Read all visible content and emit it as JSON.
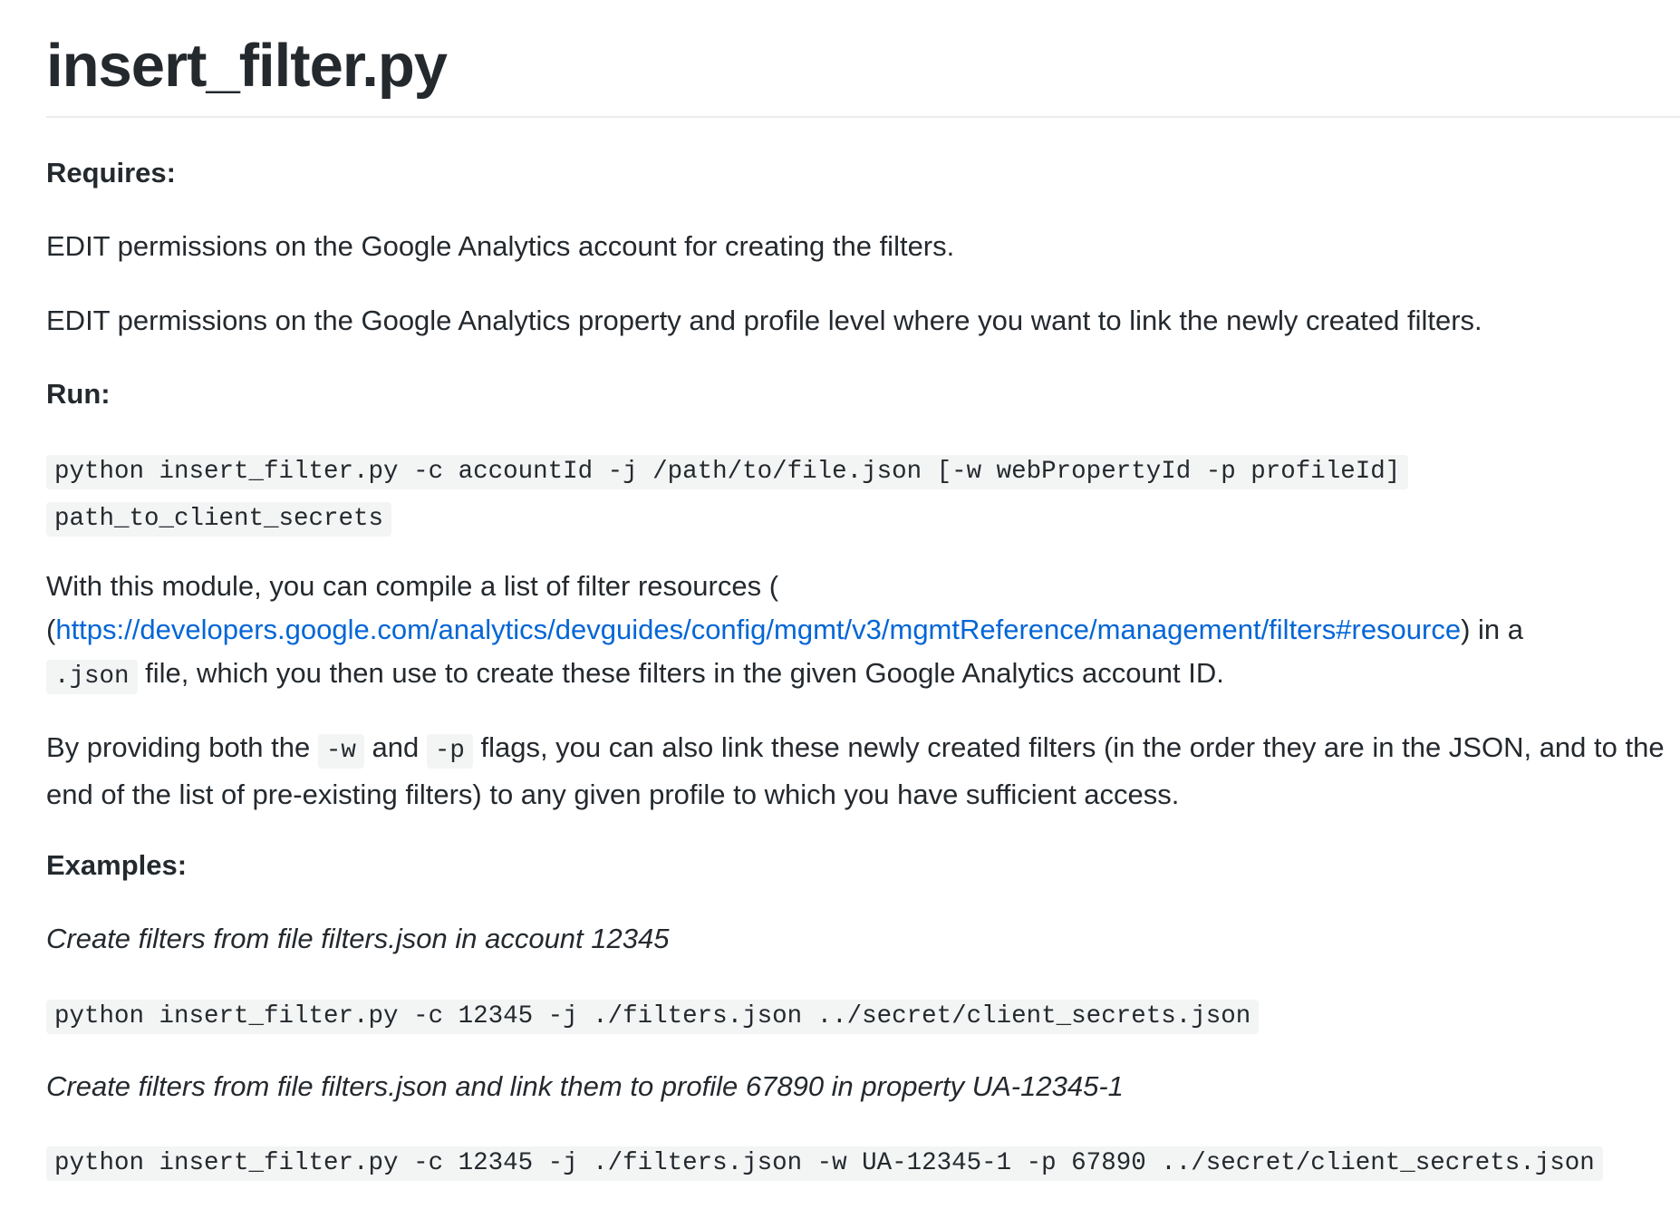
{
  "title": "insert_filter.py",
  "requires": {
    "heading": "Requires:",
    "line1": "EDIT permissions on the Google Analytics account for creating the filters.",
    "line2": "EDIT permissions on the Google Analytics property and profile level where you want to link the newly created filters."
  },
  "run": {
    "heading": "Run:",
    "command": "python insert_filter.py -c accountId -j /path/to/file.json [-w webPropertyId -p profileId] path_to_client_secrets"
  },
  "module": {
    "text_before": "With this module, you can compile a list of filter resources (",
    "link": "https://developers.google.com/analytics/devguides/config/mgmt/v3/mgmtReference/management/filters#resource",
    "text_after_link": ") in a",
    "code": ".json",
    "text_end": " file, which you then use to create these filters in the given Google Analytics account ID."
  },
  "flags": {
    "text1": "By providing both the ",
    "code_w": "-w",
    "text2": " and ",
    "code_p": "-p",
    "text3": " flags, you can also link these newly created filters (in the order they are in the JSON, and to the end of the list of pre-existing filters) to any given profile to which you have sufficient access."
  },
  "examples": {
    "heading": "Examples:",
    "items": [
      {
        "caption": "Create filters from file filters.json in account 12345",
        "command": "python insert_filter.py -c 12345 -j ./filters.json ../secret/client_secrets.json"
      },
      {
        "caption": "Create filters from file filters.json and link them to profile 67890 in property UA-12345-1",
        "command": "python insert_filter.py -c 12345 -j ./filters.json -w UA-12345-1 -p 67890 ../secret/client_secrets.json"
      }
    ]
  },
  "colors": {
    "text": "#24292e",
    "link": "#0366d6",
    "code_background": "#f3f4f4",
    "rule": "#eaecef"
  }
}
